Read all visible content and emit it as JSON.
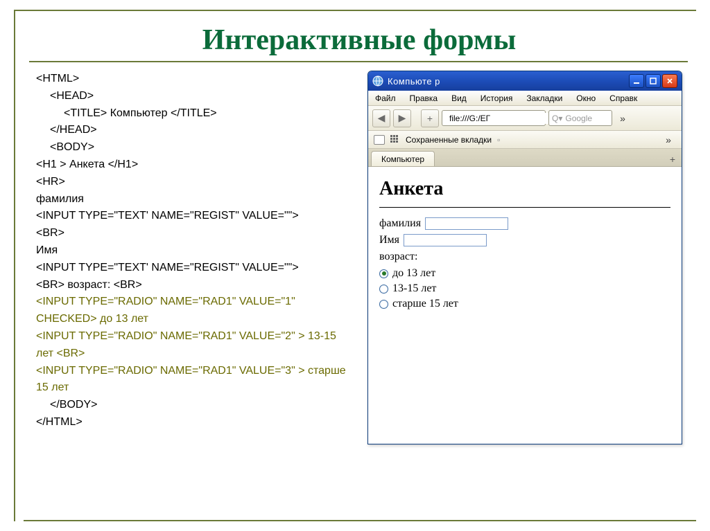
{
  "slide": {
    "title": "Интерактивные формы"
  },
  "code": {
    "lines": [
      {
        "text": "<HTML>"
      },
      {
        "text": "<HEAD>",
        "indent": 1
      },
      {
        "text": "<TITLE> Компьютер </TITLE>",
        "indent": 2
      },
      {
        "text": "</HEAD>",
        "indent": 1
      },
      {
        "text": "<BODY>",
        "indent": 1
      },
      {
        "text": "<H1 > Анкета </H1>"
      },
      {
        "text": "<HR>"
      },
      {
        "text": "фамилия"
      },
      {
        "text": "<INPUT TYPE=\"TEXT' NAME=\"REGIST\" VALUE=\"\">"
      },
      {
        "text": "<BR>"
      },
      {
        "text": "Имя"
      },
      {
        "text": "<INPUT TYPE=\"TEXT' NAME=\"REGIST\" VALUE=\"\">"
      },
      {
        "text": "<BR> возраст: <BR>"
      },
      {
        "text": "<INPUT TYPE=\"RADIO\" NAME=\"RAD1\" VALUE=\"1\" CHECKED> до 13 лет",
        "olive": true
      },
      {
        "text": "<INPUT TYPE=\"RADIO\" NAME=\"RAD1\" VALUE=\"2\" > 13-15 лет <BR>",
        "olive": true
      },
      {
        "text": "<INPUT TYPE=\"RADIO\" NAME=\"RAD1\" VALUE=\"3\" > старше 15 лет",
        "olive": true
      },
      {
        "text": "</BODY>",
        "indent": 1
      },
      {
        "text": "</HTML>"
      }
    ]
  },
  "browser": {
    "title": "Компьюте р",
    "menu": [
      "Файл",
      "Правка",
      "Вид",
      "История",
      "Закладки",
      "Окно",
      "Справк"
    ],
    "url": "file:///G:/ЕГ",
    "search_placeholder": "Google",
    "bookmarks_label": "Сохраненные вкладки",
    "tab_label": "Компьютер",
    "page": {
      "h1": "Анкета",
      "surname_label": "фамилия",
      "name_label": "Имя",
      "age_label": "возраст:",
      "radios": [
        {
          "label": "до 13 лет",
          "checked": true
        },
        {
          "label": "13-15 лет",
          "checked": false
        },
        {
          "label": "старше 15 лет",
          "checked": false
        }
      ]
    }
  }
}
